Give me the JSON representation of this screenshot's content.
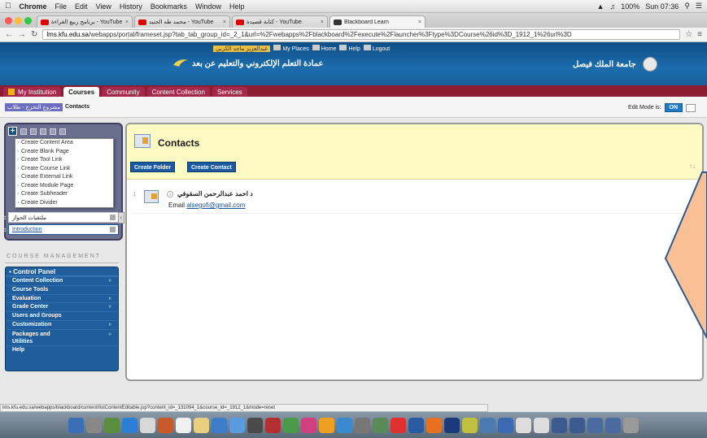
{
  "menubar": {
    "app": "Chrome",
    "items": [
      "File",
      "Edit",
      "View",
      "History",
      "Bookmarks",
      "Window",
      "Help"
    ],
    "battery": "100%",
    "clock": "Sun 07:36"
  },
  "browser": {
    "tabs": [
      {
        "label": "برنامج ربيع القراءة - YouTube",
        "active": false
      },
      {
        "label": "محمد طه الجنيد - YouTube",
        "active": false
      },
      {
        "label": "كتابة قصيدة - YouTube",
        "active": false
      },
      {
        "label": "Blackboard Learn",
        "active": true
      }
    ],
    "url_host": "lms.kfu.edu.sa",
    "url_path": "/webapps/portal/frameset.jsp?tab_tab_group_id=_2_1&url=%2Fwebapps%2Fblackboard%2Fexecute%2Flauncher%3Ftype%3DCourse%26id%3D_1912_1%26url%3D"
  },
  "header": {
    "user": "عبدالعزيز ماجد الكربي",
    "my_places": "My Places",
    "home": "Home",
    "help": "Help",
    "logout": "Logout",
    "deanship": "عمادة التعلم الإلكتروني والتعليم عن بعد",
    "university": "جامعة الملك فيصل"
  },
  "tabs": [
    {
      "label": "My Institution",
      "active": false
    },
    {
      "label": "Courses",
      "active": true
    },
    {
      "label": "Community",
      "active": false
    },
    {
      "label": "Content Collection",
      "active": false
    },
    {
      "label": "Services",
      "active": false
    }
  ],
  "breadcrumb": {
    "course": "مشروع التخرج - طلاب",
    "page": "Contacts"
  },
  "edit_mode": {
    "label": "Edit Mode is:",
    "value": "ON"
  },
  "course_menu": {
    "dropdown": [
      "Create Content Area",
      "Create Blank Page",
      "Create Tool Link",
      "Create Course Link",
      "Create External Link",
      "Create Module Page",
      "Create Subheader",
      "Create Divider"
    ],
    "items": [
      {
        "label": "ملتقيات الحوار",
        "link": false
      },
      {
        "label": "Introduction",
        "link": true
      }
    ]
  },
  "course_management": {
    "title": "COURSE MANAGEMENT",
    "panel_title": "Control Panel",
    "items": [
      {
        "label": "Content Collection",
        "arrow": true
      },
      {
        "label": "Course Tools",
        "arrow": false
      },
      {
        "label": "Evaluation",
        "arrow": true
      },
      {
        "label": "Grade Center",
        "arrow": true
      },
      {
        "label": "Users and Groups",
        "arrow": false
      },
      {
        "label": "Customization",
        "arrow": true
      },
      {
        "label": "Packages and Utilities",
        "arrow": true
      },
      {
        "label": "Help",
        "arrow": false
      }
    ]
  },
  "content": {
    "title": "Contacts",
    "create_folder": "Create Folder",
    "create_contact": "Create Contact",
    "contact": {
      "name": "د احمد عبدالرحمن السقوفي",
      "email_label": "Email",
      "email": "alsegofi@gmail.com"
    }
  },
  "status_url": "lms.kfu.edu.sa/webapps/blackboard/content/listContentEditable.jsp?content_id=_131094_1&course_id=_1912_1&mode=reset",
  "colors": {
    "header_blue": "#1c6cad",
    "tab_maroon": "#8c1c31",
    "content_header": "#fdfbc3",
    "control_panel": "#1f5d9c",
    "overlay_fill": "#f9c096",
    "overlay_stroke": "#2e5a8a"
  }
}
